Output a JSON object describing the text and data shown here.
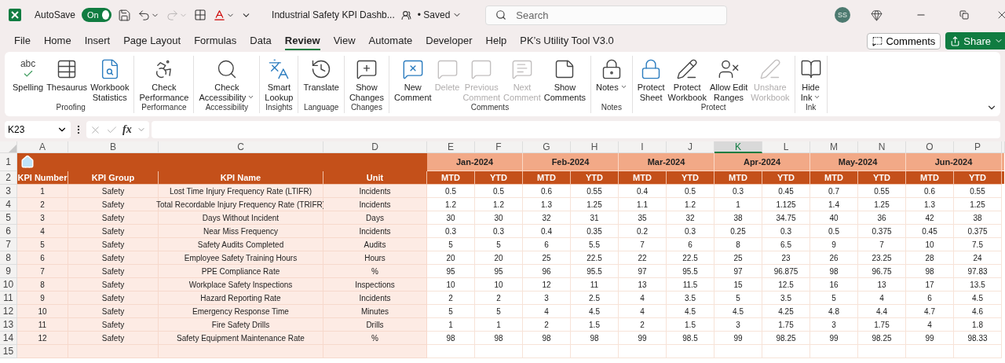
{
  "titlebar": {
    "autosave_label": "AutoSave",
    "autosave": {
      "label": "On",
      "on": true
    },
    "redo_disabled": true,
    "title": "Industrial Safety KPI Dashb...",
    "status": "• Saved",
    "search": {
      "placeholder": "Search"
    },
    "avatar": "SS"
  },
  "menu": {
    "tabs": [
      {
        "label": "File",
        "selected": false
      },
      {
        "label": "Home",
        "selected": false
      },
      {
        "label": "Insert",
        "selected": false
      },
      {
        "label": "Page Layout",
        "selected": false
      },
      {
        "label": "Formulas",
        "selected": false
      },
      {
        "label": "Data",
        "selected": false
      },
      {
        "label": "Review",
        "selected": true
      },
      {
        "label": "View",
        "selected": false
      },
      {
        "label": "Automate",
        "selected": false
      },
      {
        "label": "Developer",
        "selected": false
      },
      {
        "label": "Help",
        "selected": false
      },
      {
        "label": "PK’s Utility Tool V3.0",
        "selected": false
      }
    ],
    "comments_button": "Comments",
    "share_button": "Share"
  },
  "ribbon": {
    "groups": [
      {
        "label": "Proofing",
        "buttons": [
          {
            "label": "Spelling",
            "icon_text": "abc",
            "disabled": false,
            "dropdown": false
          },
          {
            "label": "Thesaurus",
            "disabled": false,
            "dropdown": false
          },
          {
            "label": "Workbook\nStatistics",
            "disabled": false,
            "dropdown": false
          }
        ]
      },
      {
        "label": "Performance",
        "buttons": [
          {
            "label": "Check\nPerformance",
            "disabled": false,
            "dropdown": false
          }
        ]
      },
      {
        "label": "Accessibility",
        "buttons": [
          {
            "label": "Check\nAccessibility",
            "disabled": false,
            "dropdown": true
          }
        ]
      },
      {
        "label": "Insights",
        "buttons": [
          {
            "label": "Smart\nLookup",
            "disabled": false,
            "dropdown": false
          }
        ]
      },
      {
        "label": "Language",
        "buttons": [
          {
            "label": "Translate",
            "disabled": false,
            "dropdown": false
          }
        ]
      },
      {
        "label": "Changes",
        "buttons": [
          {
            "label": "Show\nChanges",
            "disabled": false,
            "dropdown": false
          }
        ]
      },
      {
        "label": "Comments",
        "buttons": [
          {
            "label": "New\nComment",
            "disabled": false,
            "dropdown": false
          },
          {
            "label": "Delete",
            "disabled": true,
            "dropdown": false
          },
          {
            "label": "Previous\nComment",
            "disabled": true,
            "dropdown": false
          },
          {
            "label": "Next\nComment",
            "disabled": true,
            "dropdown": false
          },
          {
            "label": "Show\nComments",
            "disabled": false,
            "dropdown": false
          }
        ]
      },
      {
        "label": "Notes",
        "buttons": [
          {
            "label": "Notes",
            "disabled": false,
            "dropdown": true
          }
        ]
      },
      {
        "label": "Protect",
        "buttons": [
          {
            "label": "Protect\nSheet",
            "disabled": false,
            "dropdown": false
          },
          {
            "label": "Protect\nWorkbook",
            "disabled": false,
            "dropdown": false
          },
          {
            "label": "Allow Edit\nRanges",
            "disabled": false,
            "dropdown": false
          },
          {
            "label": "Unshare\nWorkbook",
            "disabled": true,
            "dropdown": false
          }
        ]
      },
      {
        "label": "Ink",
        "buttons": [
          {
            "label": "Hide\nInk",
            "disabled": false,
            "dropdown": true
          }
        ]
      }
    ]
  },
  "formula_bar": {
    "name_box": "K23",
    "fx": "fx"
  },
  "sheet": {
    "columns": [
      {
        "letter": "A",
        "selected": false
      },
      {
        "letter": "B",
        "selected": false
      },
      {
        "letter": "C",
        "selected": false
      },
      {
        "letter": "D",
        "selected": false
      },
      {
        "letter": "E",
        "selected": false
      },
      {
        "letter": "F",
        "selected": false
      },
      {
        "letter": "G",
        "selected": false
      },
      {
        "letter": "H",
        "selected": false
      },
      {
        "letter": "I",
        "selected": false
      },
      {
        "letter": "J",
        "selected": false
      },
      {
        "letter": "K",
        "selected": true
      },
      {
        "letter": "L",
        "selected": false
      },
      {
        "letter": "M",
        "selected": false
      },
      {
        "letter": "N",
        "selected": false
      },
      {
        "letter": "O",
        "selected": false
      },
      {
        "letter": "P",
        "selected": false
      }
    ],
    "row_numbers": [
      "1",
      "2",
      "3",
      "4",
      "5",
      "6",
      "7",
      "8",
      "9",
      "10",
      "11",
      "12",
      "13",
      "14",
      "15"
    ],
    "months": [
      "Jan-2024",
      "Feb-2024",
      "Mar-2024",
      "Apr-2024",
      "May-2024",
      "Jun-2024"
    ],
    "headers": [
      "KPI Number",
      "KPI Group",
      "KPI Name",
      "Unit"
    ],
    "sub_headers": [
      "MTD",
      "YTD",
      "MTD",
      "YTD",
      "MTD",
      "YTD",
      "MTD",
      "YTD",
      "MTD",
      "YTD",
      "MTD",
      "YTD"
    ],
    "rows": [
      {
        "number": "1",
        "group": "Safety",
        "name": "Lost Time Injury Frequency Rate (LTIFR)",
        "unit": "Incidents",
        "values": [
          "0.5",
          "0.5",
          "0.6",
          "0.55",
          "0.4",
          "0.5",
          "0.3",
          "0.45",
          "0.7",
          "0.55",
          "0.6",
          "0.55"
        ]
      },
      {
        "number": "2",
        "group": "Safety",
        "name": "Total Recordable Injury Frequency Rate (TRIFR)",
        "unit": "Incidents",
        "values": [
          "1.2",
          "1.2",
          "1.3",
          "1.25",
          "1.1",
          "1.2",
          "1",
          "1.125",
          "1.4",
          "1.25",
          "1.3",
          "1.25"
        ]
      },
      {
        "number": "3",
        "group": "Safety",
        "name": "Days Without Incident",
        "unit": "Days",
        "values": [
          "30",
          "30",
          "32",
          "31",
          "35",
          "32",
          "38",
          "34.75",
          "40",
          "36",
          "42",
          "38"
        ]
      },
      {
        "number": "4",
        "group": "Safety",
        "name": "Near Miss Frequency",
        "unit": "Incidents",
        "values": [
          "0.3",
          "0.3",
          "0.4",
          "0.35",
          "0.2",
          "0.3",
          "0.25",
          "0.3",
          "0.5",
          "0.375",
          "0.45",
          "0.375"
        ]
      },
      {
        "number": "5",
        "group": "Safety",
        "name": "Safety Audits Completed",
        "unit": "Audits",
        "values": [
          "5",
          "5",
          "6",
          "5.5",
          "7",
          "6",
          "8",
          "6.5",
          "9",
          "7",
          "10",
          "7.5"
        ]
      },
      {
        "number": "6",
        "group": "Safety",
        "name": "Employee Safety Training Hours",
        "unit": "Hours",
        "values": [
          "20",
          "20",
          "25",
          "22.5",
          "22",
          "22.5",
          "25",
          "23",
          "26",
          "23.25",
          "28",
          "24"
        ]
      },
      {
        "number": "7",
        "group": "Safety",
        "name": "PPE Compliance Rate",
        "unit": "%",
        "values": [
          "95",
          "95",
          "96",
          "95.5",
          "97",
          "95.5",
          "97",
          "96.875",
          "98",
          "96.75",
          "98",
          "97.83"
        ]
      },
      {
        "number": "8",
        "group": "Safety",
        "name": "Workplace Safety Inspections",
        "unit": "Inspections",
        "values": [
          "10",
          "10",
          "12",
          "11",
          "13",
          "11.5",
          "15",
          "12.5",
          "16",
          "13",
          "17",
          "13.5"
        ]
      },
      {
        "number": "9",
        "group": "Safety",
        "name": "Hazard Reporting Rate",
        "unit": "Incidents",
        "values": [
          "2",
          "2",
          "3",
          "2.5",
          "4",
          "3.5",
          "5",
          "3.5",
          "5",
          "4",
          "6",
          "4.5"
        ]
      },
      {
        "number": "10",
        "group": "Safety",
        "name": "Emergency Response Time",
        "unit": "Minutes",
        "values": [
          "5",
          "5",
          "4",
          "4.5",
          "4",
          "4.5",
          "4.5",
          "4.25",
          "4.8",
          "4.4",
          "4.7",
          "4.6"
        ]
      },
      {
        "number": "11",
        "group": "Safety",
        "name": "Fire Safety Drills",
        "unit": "Drills",
        "values": [
          "1",
          "1",
          "2",
          "1.5",
          "2",
          "1.5",
          "3",
          "1.75",
          "3",
          "1.75",
          "4",
          "1.8"
        ]
      },
      {
        "number": "12",
        "group": "Safety",
        "name": "Safety Equipment Maintenance Rate",
        "unit": "%",
        "values": [
          "98",
          "98",
          "98",
          "98",
          "99",
          "98.5",
          "99",
          "98.25",
          "99",
          "98.25",
          "99",
          "98.33"
        ]
      }
    ]
  }
}
